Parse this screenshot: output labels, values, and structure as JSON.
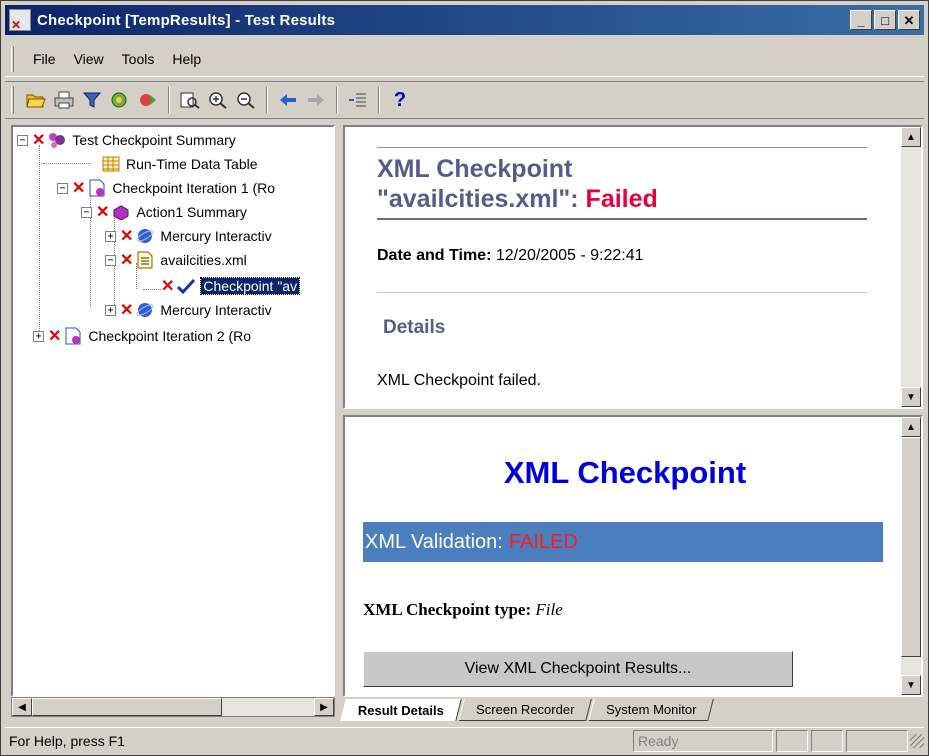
{
  "window": {
    "title": "Checkpoint [TempResults] - Test Results",
    "minimize": "_",
    "maximize": "□",
    "close": "✕"
  },
  "menu": {
    "items": [
      "File",
      "View",
      "Tools",
      "Help"
    ]
  },
  "toolbar": {
    "help": "?"
  },
  "tree": {
    "root": "Test Checkpoint Summary",
    "runtime_table": "Run-Time Data Table",
    "iteration1": "Checkpoint Iteration 1 (Ro",
    "action1": "Action1 Summary",
    "mercury1": "Mercury Interactiv",
    "availcities": "availcities.xml",
    "checkpoint": "Checkpoint \"av",
    "mercury2": "Mercury Interactiv",
    "iteration2": "Checkpoint Iteration 2 (Ro",
    "plus": "+",
    "minus": "−"
  },
  "details": {
    "title_part1": "XML Checkpoint",
    "title_part2": "\"availcities.xml\": ",
    "status": "Failed",
    "date_label": "Date and Time:",
    "date_value": " 12/20/2005 - 9:22:41",
    "details_heading": "Details",
    "message": "XML Checkpoint failed."
  },
  "checkpoint_view": {
    "title": "XML Checkpoint",
    "validation_label": "XML Validation:",
    "validation_status": "FAILED",
    "type_label": "XML Checkpoint type:",
    "type_value": "File",
    "results_button": "View XML Checkpoint Results..."
  },
  "tabs": [
    "Result Details",
    "Screen Recorder",
    "System Monitor"
  ],
  "status_bar": {
    "help_text": "For Help, press F1",
    "state": "Ready"
  },
  "colors": {
    "title_bar": "#0a246a",
    "failed_red": "#e8003c",
    "heading_blue": "#0000d8",
    "validation_bar": "#4a7ebf",
    "selection": "#0a246a"
  }
}
